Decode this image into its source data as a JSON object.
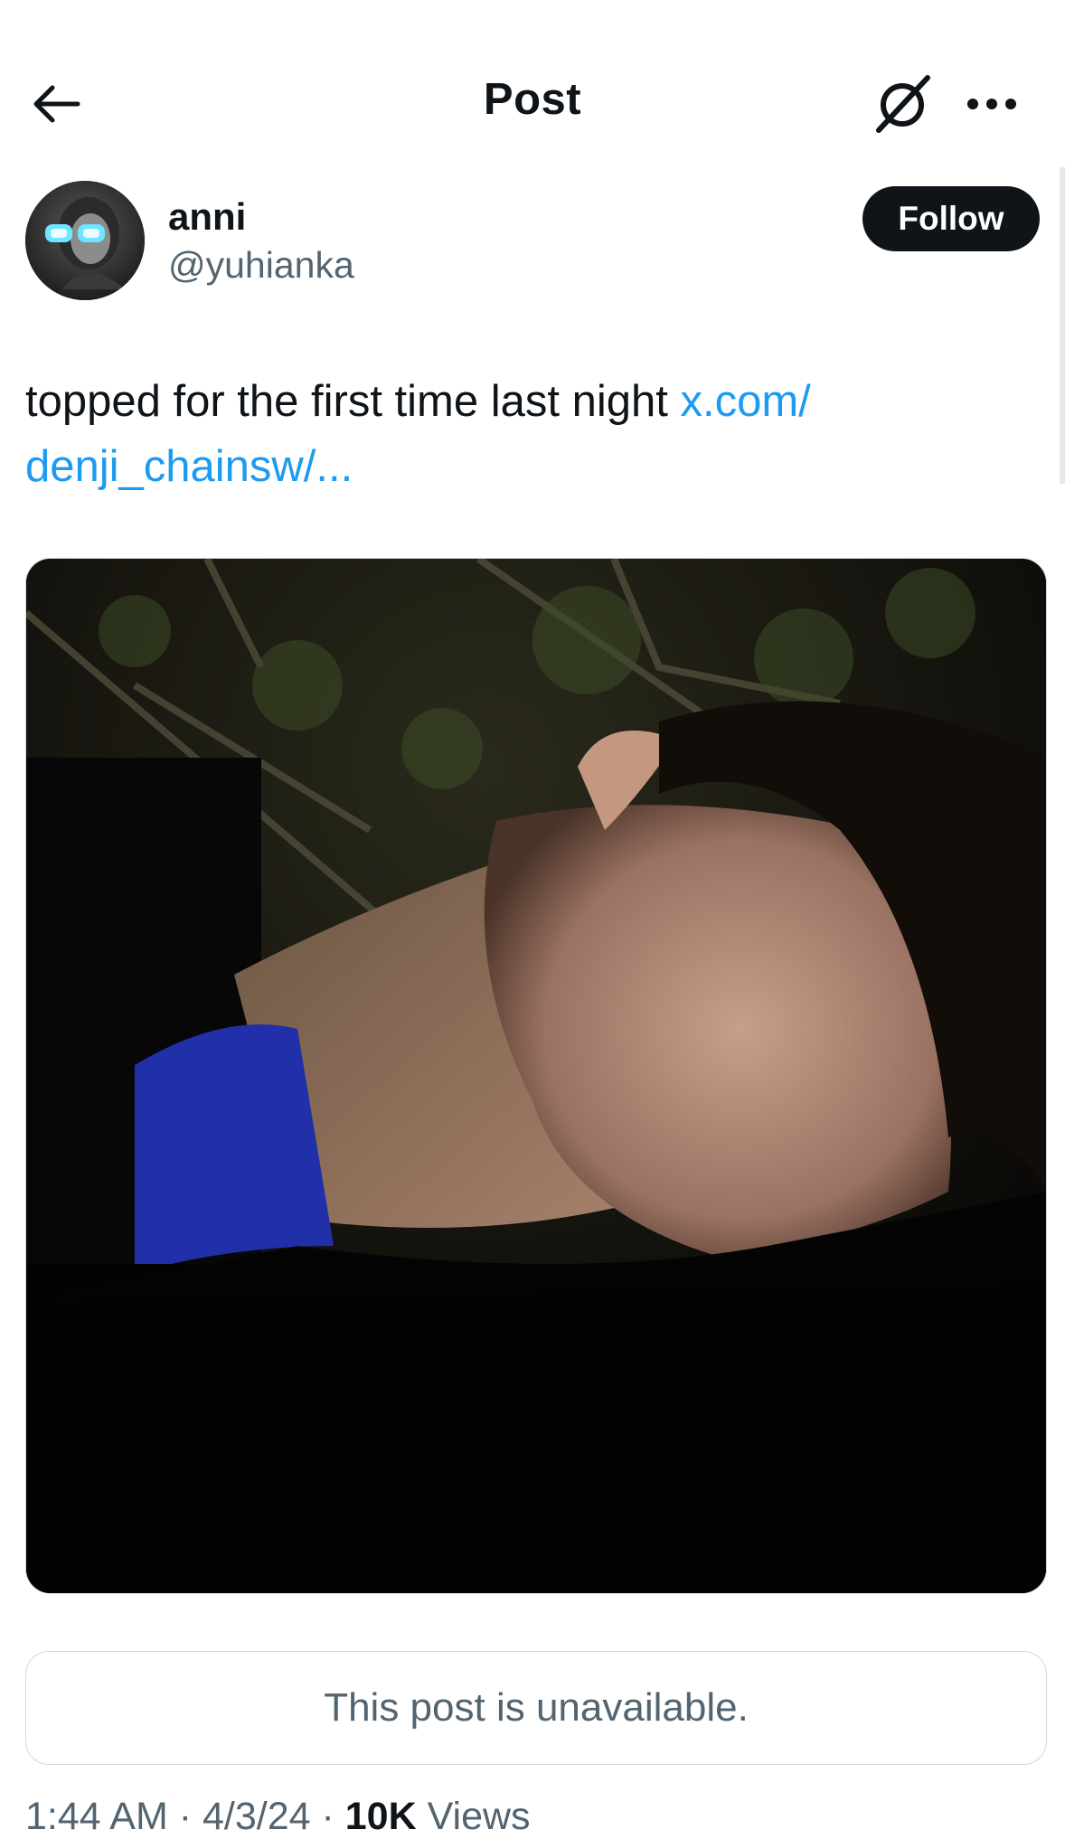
{
  "header": {
    "title": "Post",
    "back_icon": "arrow-left-icon",
    "grok_icon": "grok-slash-circle-icon",
    "more_icon": "more-horizontal-icon"
  },
  "author": {
    "name": "anni",
    "handle": "@yuhianka",
    "follow_label": "Follow",
    "avatar_icon": "avatar-image"
  },
  "post": {
    "text": "topped for the first time last night ",
    "link_text": "x.com/\ndenji_chainsw/...",
    "link_line1": "x.com/",
    "link_line2": "denji_chainsw/..."
  },
  "quoted": {
    "message": "This post is unavailable."
  },
  "meta": {
    "time": "1:44 AM",
    "separator": " · ",
    "date": "4/3/24",
    "views_count": "10K",
    "views_label": "Views"
  },
  "colors": {
    "text": "#0f1419",
    "secondary": "#536471",
    "link": "#1d9bf0",
    "border": "#cfd9de"
  }
}
